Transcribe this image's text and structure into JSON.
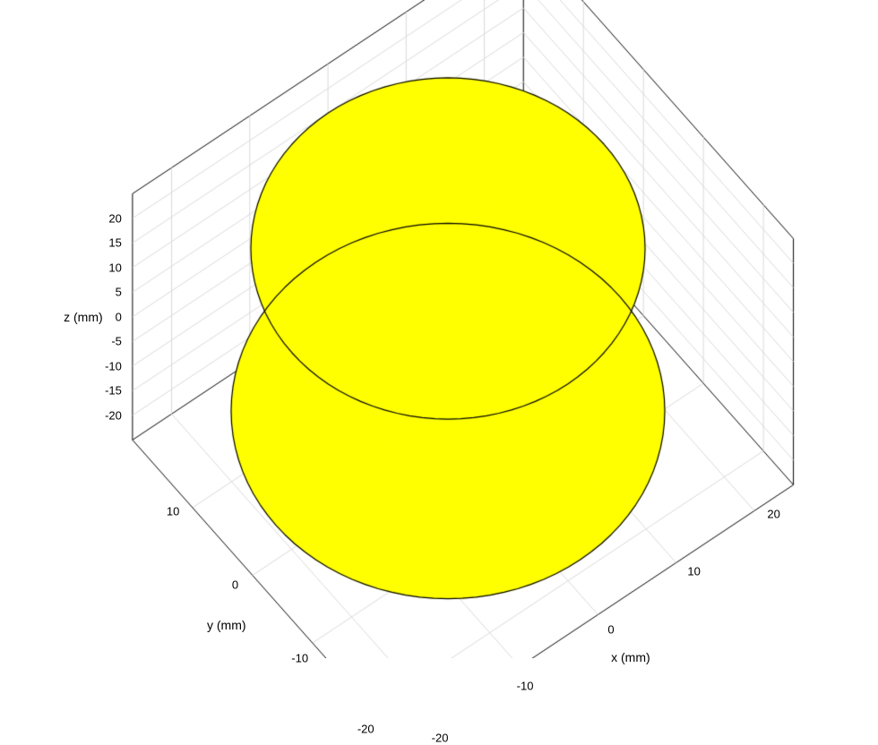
{
  "chart_data": {
    "type": "surface3d",
    "description": "3D surface plot of a biconical (hourglass-shaped) solid with spherical end caps, rendered in solid yellow with black edge outlines at the cone-cap junctions.",
    "color": "#ffff00",
    "edge_color": "#000000",
    "axes": {
      "x": {
        "label": "x (mm)",
        "lim": [
          -25,
          25
        ],
        "ticks": [
          -20,
          -10,
          0,
          10,
          20
        ]
      },
      "y": {
        "label": "y (mm)",
        "lim": [
          -25,
          20
        ],
        "ticks": [
          -20,
          -10,
          0,
          10
        ]
      },
      "z": {
        "label": "z (mm)",
        "lim": [
          -25,
          25
        ],
        "ticks": [
          -20,
          -15,
          -10,
          -5,
          0,
          5,
          10,
          15,
          20
        ]
      }
    },
    "geometry": {
      "upper_cone": {
        "apex_z": 0,
        "base_z": 15,
        "base_radius": 20
      },
      "upper_cap": {
        "type": "spherical",
        "rim_z": 15,
        "rim_radius": 20,
        "top_z": 22
      },
      "lower_cone": {
        "apex_z": 0,
        "base_z": -18,
        "base_radius": 22
      },
      "lower_cap": {
        "type": "spherical",
        "rim_z": -18,
        "rim_radius": 22,
        "bottom_z": -25
      }
    },
    "view": {
      "azimuth_deg": -37.5,
      "elevation_deg": 30
    }
  }
}
